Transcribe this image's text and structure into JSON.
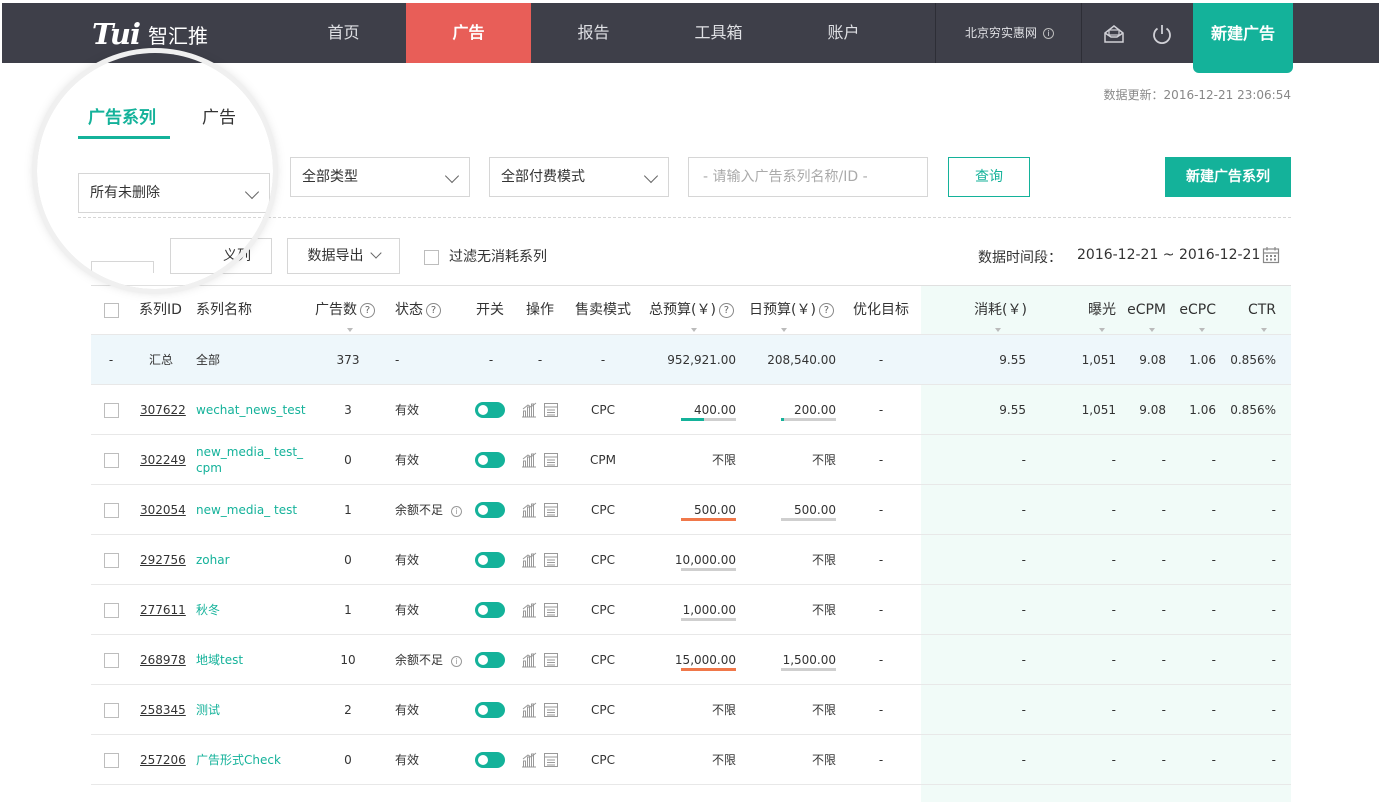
{
  "brand": {
    "logo_text": "Tui",
    "name": "智汇推"
  },
  "nav": [
    {
      "label": "首页",
      "active": false
    },
    {
      "label": "广告",
      "active": true
    },
    {
      "label": "报告",
      "active": false
    },
    {
      "label": "工具箱",
      "active": false
    },
    {
      "label": "账户",
      "active": false
    }
  ],
  "account": {
    "name": "北京穷实惠网"
  },
  "header_buttons": {
    "new_ad": "新建广告"
  },
  "data_updated": "数据更新：2016-12-21 23:06:54",
  "tabs": [
    {
      "label": "广告系列",
      "active": true
    },
    {
      "label": "广告",
      "active": false
    }
  ],
  "filters": {
    "status": "所有未删除",
    "type": "全部类型",
    "pay_mode": "全部付费模式",
    "search_placeholder": "- 请输入广告系列名称/ID -",
    "query_button": "查询",
    "new_series_button": "新建广告系列"
  },
  "toolbar": {
    "custom_columns": "义列",
    "export": "数据导出",
    "filter_zero": "过滤无消耗系列",
    "date_label": "数据时间段：",
    "date_range": "2016-12-21 ~ 2016-12-21"
  },
  "table": {
    "headers": {
      "id": "系列ID",
      "name": "系列名称",
      "ads": "广告数",
      "status": "状态",
      "switch": "开关",
      "ops": "操作",
      "sell_mode": "售卖模式",
      "total_budget": "总预算(￥)",
      "daily_budget": "日预算(￥)",
      "target": "优化目标",
      "cost": "消耗(￥)",
      "impressions": "曝光",
      "ecpm": "eCPM",
      "ecpc": "eCPC",
      "ctr": "CTR"
    },
    "summary": {
      "check": "-",
      "id": "汇总",
      "name": "全部",
      "ads": "373",
      "status": "-",
      "switch": "-",
      "ops": "-",
      "sell_mode": "-",
      "total_budget": "952,921.00",
      "daily_budget": "208,540.00",
      "target": "-",
      "cost": "9.55",
      "impressions": "1,051",
      "ecpm": "9.08",
      "ecpc": "1.06",
      "ctr": "0.856%"
    },
    "rows": [
      {
        "id": "307622",
        "name": "wechat_news_test",
        "name2": "",
        "ads": "3",
        "status": "有效",
        "status_info": false,
        "sell_mode": "CPC",
        "total_budget": "400.00",
        "total_fill": 0.42,
        "total_fill_color": "#14b29a",
        "total_bar": true,
        "daily_budget": "200.00",
        "daily_fill": 0.06,
        "daily_fill_color": "#14b29a",
        "daily_bar": true,
        "target": "-",
        "cost": "9.55",
        "impressions": "1,051",
        "ecpm": "9.08",
        "ecpc": "1.06",
        "ctr": "0.856%"
      },
      {
        "id": "302249",
        "name": "new_media_ test_",
        "name2": "cpm",
        "ads": "0",
        "status": "有效",
        "status_info": false,
        "sell_mode": "CPM",
        "total_budget": "不限",
        "total_fill": 0,
        "total_fill_color": "",
        "total_bar": false,
        "daily_budget": "不限",
        "daily_fill": 0,
        "daily_fill_color": "",
        "daily_bar": false,
        "target": "-",
        "cost": "-",
        "impressions": "-",
        "ecpm": "-",
        "ecpc": "-",
        "ctr": "-"
      },
      {
        "id": "302054",
        "name": "new_media_ test",
        "name2": "",
        "ads": "1",
        "status": "余额不足",
        "status_info": true,
        "sell_mode": "CPC",
        "total_budget": "500.00",
        "total_fill": 1,
        "total_fill_color": "#f0784a",
        "total_bar": true,
        "daily_budget": "500.00",
        "daily_fill": 0,
        "daily_fill_color": "",
        "daily_bar": true,
        "target": "-",
        "cost": "-",
        "impressions": "-",
        "ecpm": "-",
        "ecpc": "-",
        "ctr": "-"
      },
      {
        "id": "292756",
        "name": "zohar",
        "name2": "",
        "ads": "0",
        "status": "有效",
        "status_info": false,
        "sell_mode": "CPC",
        "total_budget": "10,000.00",
        "total_fill": 0,
        "total_fill_color": "",
        "total_bar": true,
        "daily_budget": "不限",
        "daily_fill": 0,
        "daily_fill_color": "",
        "daily_bar": false,
        "target": "-",
        "cost": "-",
        "impressions": "-",
        "ecpm": "-",
        "ecpc": "-",
        "ctr": "-"
      },
      {
        "id": "277611",
        "name": "秋冬",
        "name2": "",
        "ads": "1",
        "status": "有效",
        "status_info": false,
        "sell_mode": "CPC",
        "total_budget": "1,000.00",
        "total_fill": 0,
        "total_fill_color": "",
        "total_bar": true,
        "daily_budget": "不限",
        "daily_fill": 0,
        "daily_fill_color": "",
        "daily_bar": false,
        "target": "-",
        "cost": "-",
        "impressions": "-",
        "ecpm": "-",
        "ecpc": "-",
        "ctr": "-"
      },
      {
        "id": "268978",
        "name": "地域test",
        "name2": "",
        "ads": "10",
        "status": "余额不足",
        "status_info": true,
        "sell_mode": "CPC",
        "total_budget": "15,000.00",
        "total_fill": 1,
        "total_fill_color": "#f0784a",
        "total_bar": true,
        "daily_budget": "1,500.00",
        "daily_fill": 0,
        "daily_fill_color": "",
        "daily_bar": true,
        "target": "-",
        "cost": "-",
        "impressions": "-",
        "ecpm": "-",
        "ecpc": "-",
        "ctr": "-"
      },
      {
        "id": "258345",
        "name": "测试",
        "name2": "",
        "ads": "2",
        "status": "有效",
        "status_info": false,
        "sell_mode": "CPC",
        "total_budget": "不限",
        "total_fill": 0,
        "total_fill_color": "",
        "total_bar": false,
        "daily_budget": "不限",
        "daily_fill": 0,
        "daily_fill_color": "",
        "daily_bar": false,
        "target": "-",
        "cost": "-",
        "impressions": "-",
        "ecpm": "-",
        "ecpc": "-",
        "ctr": "-"
      },
      {
        "id": "257206",
        "name": "广告形式Check",
        "name2": "",
        "ads": "0",
        "status": "有效",
        "status_info": false,
        "sell_mode": "CPC",
        "total_budget": "不限",
        "total_fill": 0,
        "total_fill_color": "",
        "total_bar": false,
        "daily_budget": "不限",
        "daily_fill": 0,
        "daily_fill_color": "",
        "daily_bar": false,
        "target": "-",
        "cost": "-",
        "impressions": "-",
        "ecpm": "-",
        "ecpc": "-",
        "ctr": "-"
      }
    ]
  },
  "colors": {
    "accent": "#14b29a",
    "nav_active": "#e85e58",
    "nav_bg": "#3e3f49",
    "warn_bar": "#f0784a"
  }
}
